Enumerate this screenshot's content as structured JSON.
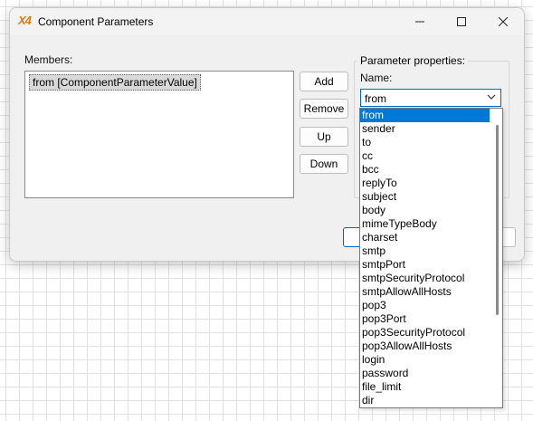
{
  "window": {
    "logo": "X4",
    "title": "Component Parameters"
  },
  "members": {
    "label": "Members:",
    "items": [
      "from [ComponentParameterValue]"
    ]
  },
  "buttons": {
    "add": "Add",
    "remove": "Remove",
    "up": "Up",
    "down": "Down"
  },
  "properties": {
    "group_label": "Parameter properties:",
    "name_label": "Name:",
    "name_value": "from"
  },
  "dropdown": {
    "selected": "from",
    "options": [
      "from",
      "sender",
      "to",
      "cc",
      "bcc",
      "replyTo",
      "subject",
      "body",
      "mimeTypeBody",
      "charset",
      "smtp",
      "smtpPort",
      "smtpSecurityProtocol",
      "smtpAllowAllHosts",
      "pop3",
      "pop3Port",
      "pop3SecurityProtocol",
      "pop3AllowAllHosts",
      "login",
      "password",
      "file_limit",
      "dir"
    ]
  },
  "icons": {
    "minimize": "minimize-icon",
    "maximize": "maximize-icon",
    "close": "close-icon",
    "combo_arrow": "chevron-down-icon"
  },
  "colors": {
    "accent": "#0078d7",
    "logo": "#e07a10"
  }
}
